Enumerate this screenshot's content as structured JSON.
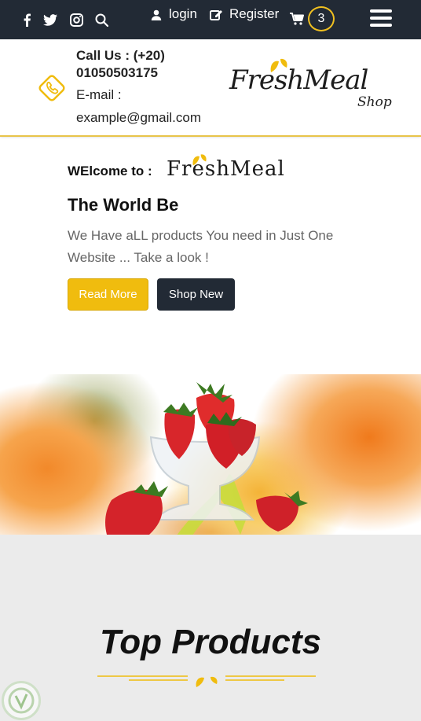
{
  "topbar": {
    "social_icons": [
      "facebook-icon",
      "twitter-icon",
      "instagram-icon",
      "search-icon"
    ],
    "login_label": "login",
    "register_label": "Register",
    "cart_count": "3",
    "accent_color": "#f0c020",
    "bg_color": "#222a35"
  },
  "header": {
    "call_label": "Call Us : (+20) 01050503175",
    "email_label": "E-mail :",
    "email_value": "example@gmail.com",
    "logo_text": "FreshMeal",
    "logo_sub": "Shop"
  },
  "hero": {
    "welcome_label": "WElcome to :",
    "brand_name": "FreshMeal",
    "title": "The World Be",
    "description": "We Have aLL products You need in Just One Website ... Take a look !",
    "read_more_label": "Read More",
    "shop_new_label": "Shop New",
    "button_color": "#f0bc0e"
  },
  "products": {
    "title": "Top Products"
  }
}
